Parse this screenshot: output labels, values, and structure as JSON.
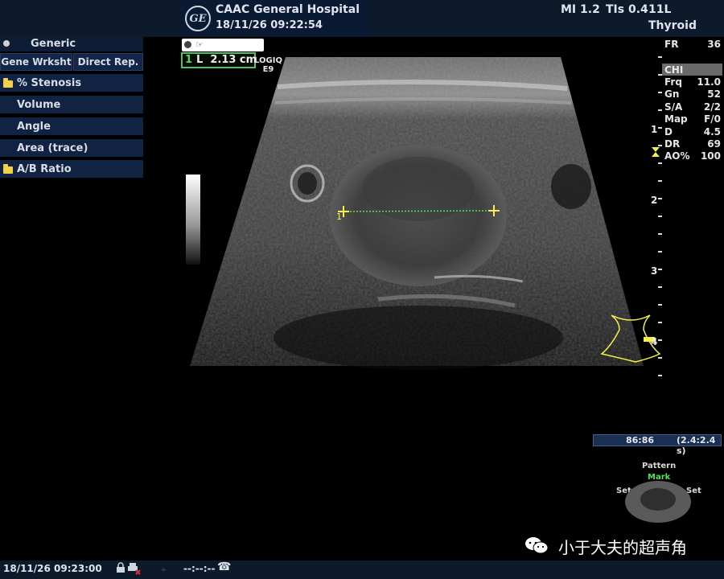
{
  "header": {
    "hospital_name": "CAAC General Hospital",
    "datetime": "18/11/26 09:22:54",
    "mi": "MI 1.2",
    "tis": "TIs 0.4",
    "probe": "11L",
    "preset": "Thyroid"
  },
  "left_menu": {
    "title": "Generic",
    "tabs": [
      "Gene Wrksht",
      "Direct Rep."
    ],
    "items": [
      {
        "label": "% Stenosis",
        "folder": true
      },
      {
        "label": "Volume",
        "folder": false
      },
      {
        "label": "Angle",
        "folder": false
      },
      {
        "label": "Area (trace)",
        "folder": false
      },
      {
        "label": "A/B Ratio",
        "folder": true
      }
    ]
  },
  "measurement": {
    "index": "1",
    "value": "L  2.13 cm",
    "scanner_model": "LOGIQ\nE9"
  },
  "params": [
    {
      "name": "FR",
      "value": "36"
    },
    {
      "name": "CHI",
      "value": ""
    },
    {
      "name": "Frq",
      "value": "11.0"
    },
    {
      "name": "Gn",
      "value": "52"
    },
    {
      "name": "S/A",
      "value": "2/2"
    },
    {
      "name": "Map",
      "value": "F/0"
    },
    {
      "name": "D",
      "value": "4.5"
    },
    {
      "name": "DR",
      "value": "69"
    },
    {
      "name": "AO%",
      "value": "100"
    }
  ],
  "depth_labels": [
    "1",
    "2",
    "3",
    "4"
  ],
  "cine": {
    "frame_counter": "86:86",
    "frame_rate": "(2.4:2.4 s)"
  },
  "trackball": {
    "pattern": "Pattern",
    "mark": "Mark",
    "set_left": "Set",
    "set_right": "Set"
  },
  "watermark": "小于大夫的超声角",
  "status": {
    "datetime": "18/11/26 09:23:00",
    "timer": "--:--:--"
  },
  "colors": {
    "measure_cursor": "#f4f14a",
    "measure_line": "#4fe05a",
    "header_bg": "#0c1a2c",
    "menu_bg": "#102342"
  }
}
